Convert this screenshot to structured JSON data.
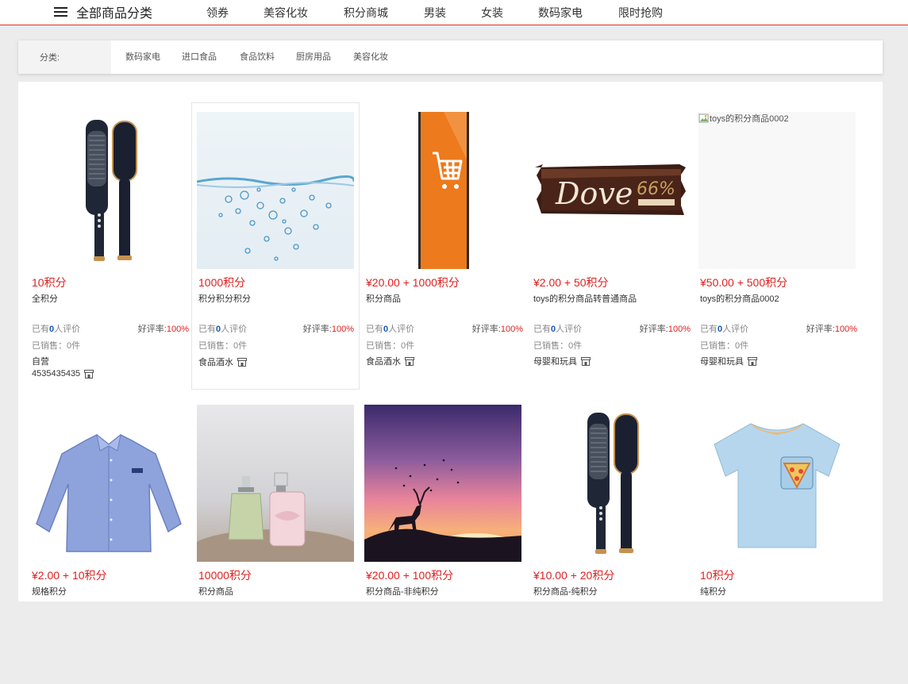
{
  "header": {
    "menu_title": "全部商品分类",
    "nav": [
      "领券",
      "美容化妆",
      "积分商城",
      "男装",
      "女装",
      "数码家电",
      "限时抢购"
    ]
  },
  "filter": {
    "label": "分类:",
    "categories": [
      "数码家电",
      "进口食品",
      "食品饮料",
      "厨房用品",
      "美容化妆"
    ]
  },
  "colors": {
    "accent": "#e01f1f",
    "nav_line": "#e02a2a",
    "review_count": "#1a56b0"
  },
  "products": [
    {
      "image": "hair-straightener-brush",
      "price": "10积分",
      "name": "全积分",
      "reviews_prefix": "已有",
      "reviews_count": "0",
      "reviews_suffix": "人评价",
      "rate_label": "好评率:",
      "rate_value": "100%",
      "sold": "已销售：0件",
      "shop": "自营",
      "shop_id": "4535435435"
    },
    {
      "image": "water-splash",
      "price": "1000积分",
      "name": "积分积分积分",
      "reviews_prefix": "已有",
      "reviews_count": "0",
      "reviews_suffix": "人评价",
      "rate_label": "好评率:",
      "rate_value": "100%",
      "sold": "已销售：0件",
      "shop": "食品酒水"
    },
    {
      "image": "orange-cart-banner",
      "price": "¥20.00 + 1000积分",
      "name": "积分商品",
      "reviews_prefix": "已有",
      "reviews_count": "0",
      "reviews_suffix": "人评价",
      "rate_label": "好评率:",
      "rate_value": "100%",
      "sold": "已销售：0件",
      "shop": "食品酒水"
    },
    {
      "image": "dove-chocolate-bar",
      "price": "¥2.00 + 50积分",
      "name": "toys的积分商品转普通商品",
      "reviews_prefix": "已有",
      "reviews_count": "0",
      "reviews_suffix": "人评价",
      "rate_label": "好评率:",
      "rate_value": "100%",
      "sold": "已销售：0件",
      "shop": "母婴和玩具"
    },
    {
      "image": "broken-image",
      "image_alt": "toys的积分商品0002",
      "price": "¥50.00 + 500积分",
      "name": "toys的积分商品0002",
      "reviews_prefix": "已有",
      "reviews_count": "0",
      "reviews_suffix": "人评价",
      "rate_label": "好评率:",
      "rate_value": "100%",
      "sold": "已销售：0件",
      "shop": "母婴和玩具"
    },
    {
      "image": "blue-shirt",
      "price": "¥2.00 + 10积分",
      "name": "规格积分"
    },
    {
      "image": "perfume-bottles",
      "price": "10000积分",
      "name": "积分商品"
    },
    {
      "image": "sunset-deer",
      "price": "¥20.00 + 100积分",
      "name": "积分商品-非纯积分"
    },
    {
      "image": "hair-straightener-brush",
      "price": "¥10.00 + 20积分",
      "name": "积分商品-纯积分"
    },
    {
      "image": "kids-tshirt",
      "price": "10积分",
      "name": "纯积分"
    }
  ]
}
